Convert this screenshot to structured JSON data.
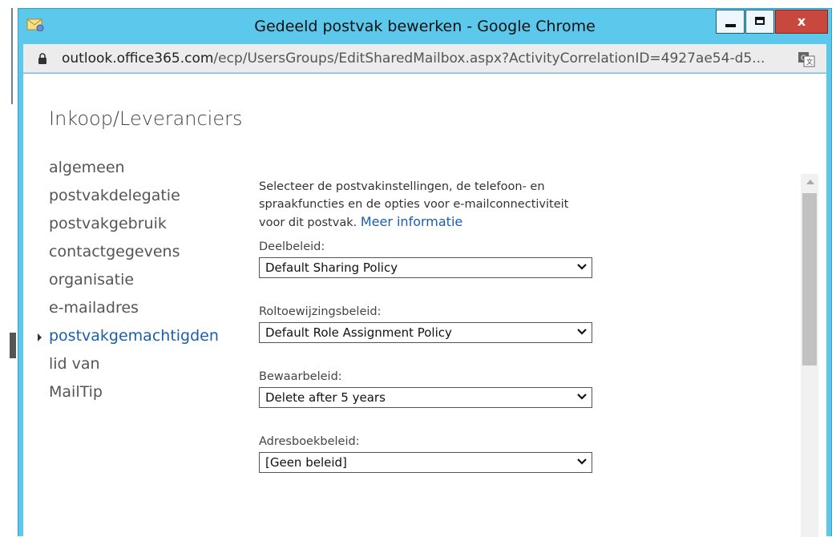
{
  "window": {
    "title": "Gedeeld postvak bewerken - Google Chrome",
    "close_label": "x"
  },
  "addressbar": {
    "url_host": "outlook.office365.com",
    "url_path": "/ecp/UsersGroups/EditSharedMailbox.aspx?ActivityCorrelationID=4927ae54-d5..."
  },
  "page": {
    "heading": "Inkoop/Leveranciers"
  },
  "nav": {
    "items": [
      {
        "label": "algemeen"
      },
      {
        "label": "postvakdelegatie"
      },
      {
        "label": "postvakgebruik"
      },
      {
        "label": "contactgegevens"
      },
      {
        "label": "organisatie"
      },
      {
        "label": "e-mailadres"
      },
      {
        "label": "postvakgemachtigden",
        "active": true
      },
      {
        "label": "lid van"
      },
      {
        "label": "MailTip"
      }
    ]
  },
  "panel": {
    "intro_line1": "Selecteer de postvakinstellingen, de telefoon- en",
    "intro_line2": "spraakfuncties en de opties voor e-mailconnectiviteit",
    "intro_line3": "voor dit postvak.",
    "more_info_link": "Meer informatie",
    "fields": [
      {
        "label": "Deelbeleid:",
        "value": "Default Sharing Policy"
      },
      {
        "label": "Roltoewijzingsbeleid:",
        "value": "Default Role Assignment Policy"
      },
      {
        "label": "Bewaarbeleid:",
        "value": "Delete after 5 years"
      },
      {
        "label": "Adresboekbeleid:",
        "value": "[Geen beleid]"
      }
    ]
  },
  "colors": {
    "window_frame": "#5bc8ec",
    "link": "#1a5fa8",
    "close_button": "#c9483d"
  }
}
